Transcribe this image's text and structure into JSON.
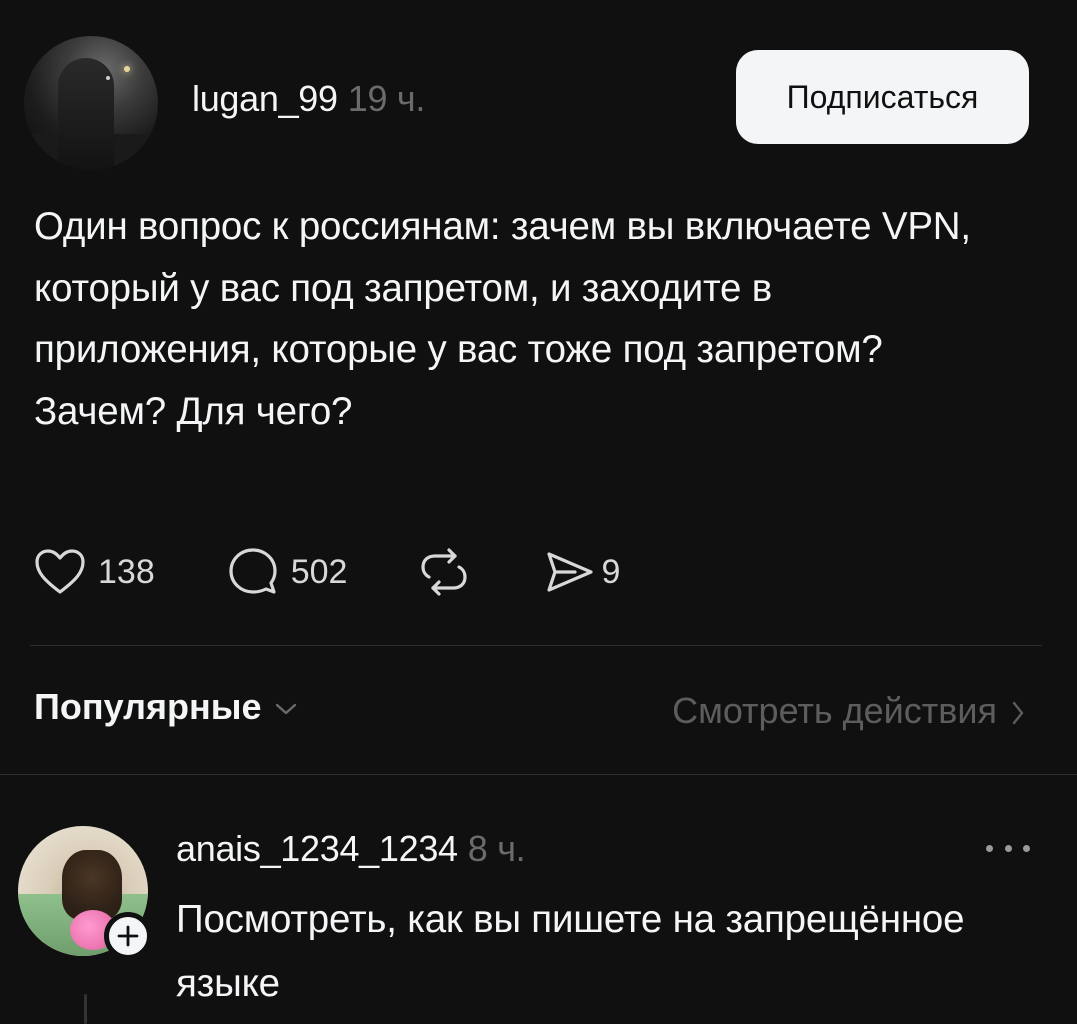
{
  "post": {
    "username": "lugan_99",
    "time": "19 ч.",
    "follow_label": "Подписаться",
    "text": "Один вопрос к россиянам: зачем вы включаете VPN, который у вас под запретом, и заходите в приложения, которые у вас тоже под запретом? Зачем? Для чего?",
    "likes": "138",
    "replies": "502",
    "shares": "9"
  },
  "sort": {
    "label": "Популярные",
    "view_actions": "Смотреть действия"
  },
  "comment": {
    "username": "anais_1234_1234",
    "time": "8 ч.",
    "text": "Посмотреть, как вы пишете на запрещённое языке"
  },
  "icons": {
    "like": "heart-icon",
    "reply": "speech-bubble-icon",
    "repost": "repost-icon",
    "share": "send-icon",
    "sort_chevron": "chevron-down-icon",
    "view_chevron": "chevron-right-icon",
    "more": "more-icon",
    "follow_plus": "plus-icon"
  }
}
